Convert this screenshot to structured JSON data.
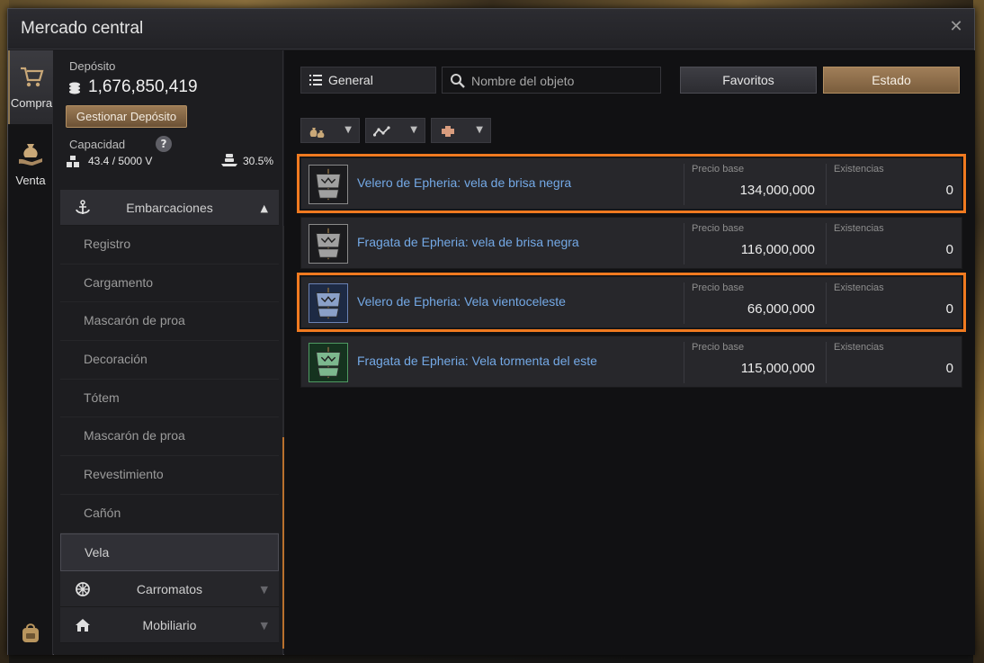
{
  "window": {
    "title": "Mercado central",
    "close": "✕"
  },
  "rail": {
    "buy_label": "Compra",
    "sell_label": "Venta"
  },
  "deposit": {
    "label": "Depósito",
    "value": "1,676,850,419",
    "manage_label": "Gestionar Depósito"
  },
  "capacity": {
    "label": "Capacidad",
    "help": "?",
    "value": "43.4 / 5000 V",
    "weight": "30.5%"
  },
  "categories": {
    "boats": {
      "label": "Embarcaciones",
      "arrow": "▲"
    },
    "sub_items": [
      "Registro",
      "Cargamento",
      "Mascarón de proa",
      "Decoración",
      "Tótem",
      "Mascarón de proa",
      "Revestimiento",
      "Cañón",
      "Vela"
    ],
    "active_index": 8,
    "wagons": {
      "label": "Carromatos",
      "arrow": "▼"
    },
    "furniture": {
      "label": "Mobiliario",
      "arrow": "▼"
    }
  },
  "toolbar": {
    "general_label": "General",
    "search_placeholder": "Nombre del objeto",
    "favorites_label": "Favoritos",
    "state_label": "Estado",
    "caret": "▼"
  },
  "items": [
    {
      "name": "Velero de Epheria: vela de brisa negra",
      "price_label": "Precio base",
      "price": "134,000,000",
      "stock_label": "Existencias",
      "stock": "0",
      "highlighted": true,
      "tint": "default"
    },
    {
      "name": "Fragata de Epheria: vela de brisa negra",
      "price_label": "Precio base",
      "price": "116,000,000",
      "stock_label": "Existencias",
      "stock": "0",
      "highlighted": false,
      "tint": "default"
    },
    {
      "name": "Velero de Epheria: Vela vientoceleste",
      "price_label": "Precio base",
      "price": "66,000,000",
      "stock_label": "Existencias",
      "stock": "0",
      "highlighted": true,
      "tint": "blue"
    },
    {
      "name": "Fragata de Epheria: Vela tormenta del este",
      "price_label": "Precio base",
      "price": "115,000,000",
      "stock_label": "Existencias",
      "stock": "0",
      "highlighted": false,
      "tint": "green"
    }
  ],
  "colors": {
    "highlight": "#f07a20",
    "accent": "#9c7b55",
    "item_name": "#74a9e6"
  }
}
